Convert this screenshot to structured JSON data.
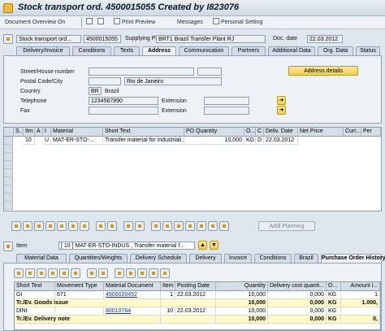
{
  "window": {
    "title": "Stock transport ord. 4500015055 Created by I823076"
  },
  "toolbar": {
    "document_overview": "Document Overview On",
    "print_preview": "Print Preview",
    "messages": "Messages",
    "personal_setting": "Personal Setting"
  },
  "header": {
    "doc_type": "Stock transport ord...",
    "po_number": "4500015055",
    "supplying_plant_label": "Supplying Plant",
    "supplying_plant_value": "BRT1 Brazil Transfer Plant RJ",
    "doc_date_label": "Doc. date",
    "doc_date_value": "22.03.2012"
  },
  "header_tabs": [
    "Delivery/Invoice",
    "Conditions",
    "Texts",
    "Address",
    "Communication",
    "Partners",
    "Additional Data",
    "Org. Data",
    "Status"
  ],
  "address": {
    "street_label": "Street/House number",
    "postal_label": "Postal Code/City",
    "city_value": "Rio de Janeiro",
    "country_label": "Country",
    "country_code": "BR",
    "country_name": "Brazil",
    "telephone_label": "Telephone",
    "telephone_value": "1234567890",
    "extension_label": "Extension",
    "fax_label": "Fax",
    "fax_extension_label": "Extension",
    "address_details_button": "Address details"
  },
  "item_table": {
    "columns": [
      "S..",
      "Itm",
      "A",
      "I",
      "Material",
      "Short Text",
      "PO Quantity",
      "O...",
      "C",
      "Deliv. Date",
      "Net Price",
      "Curr...",
      "Per"
    ],
    "rows": [
      {
        "itm": "10",
        "i": "U",
        "material": "MAT-ER-STO-...",
        "short_text": "Transfer material for industriali...",
        "po_quantity": "10,000",
        "unit": "KG",
        "c": "D",
        "deliv_date": "22.03.2012"
      }
    ]
  },
  "item_toolbar": {
    "add_planning": "Addl Planning"
  },
  "item_detail": {
    "item_label": "Item",
    "item_value": "[ 10 ] MAT-ER-STO-INDUS , Transfer material f..."
  },
  "item_tabs": [
    "Material Data",
    "Quantities/Weights",
    "Delivery Schedule",
    "Delivery",
    "Invoice",
    "Conditions",
    "Brazil",
    "Purchase Order History"
  ],
  "history_table": {
    "columns": [
      "Short Text",
      "Movement Type",
      "Material Document",
      "Item",
      "Posting Date",
      "Quantity",
      "Delivery cost quanti...",
      "O...",
      "Amount i..."
    ],
    "rows": [
      {
        "short_text": "GI",
        "movement_type": "671",
        "material_document": "4900020452",
        "item": "1",
        "posting_date": "22.03.2012",
        "quantity": "10,000",
        "delivery_cost": "0,000",
        "unit": "KG",
        "amount": "1",
        "type": "entry"
      },
      {
        "short_text": "Tr./Ev. Goods issue",
        "movement_type": "",
        "material_document": "",
        "item": "",
        "posting_date": "",
        "quantity": "10,000",
        "delivery_cost": "0,000",
        "unit": "KG",
        "amount": "1.000,",
        "type": "total"
      },
      {
        "short_text": "DlNt",
        "movement_type": "",
        "material_document": "80010764",
        "item": "10",
        "posting_date": "22.03.2012",
        "quantity": "10,000",
        "delivery_cost": "0,000",
        "unit": "KG",
        "amount": "",
        "type": "entry"
      },
      {
        "short_text": "Tr./Ev. Delivery note",
        "movement_type": "",
        "material_document": "",
        "item": "",
        "posting_date": "",
        "quantity": "10,000",
        "delivery_cost": "0,000",
        "unit": "KG",
        "amount": "0,",
        "type": "total"
      }
    ]
  },
  "colors": {
    "title_text": "#0a1a2a",
    "link": "#0033cc",
    "total_row": "#fffacd",
    "button": "#f1cf4f"
  }
}
